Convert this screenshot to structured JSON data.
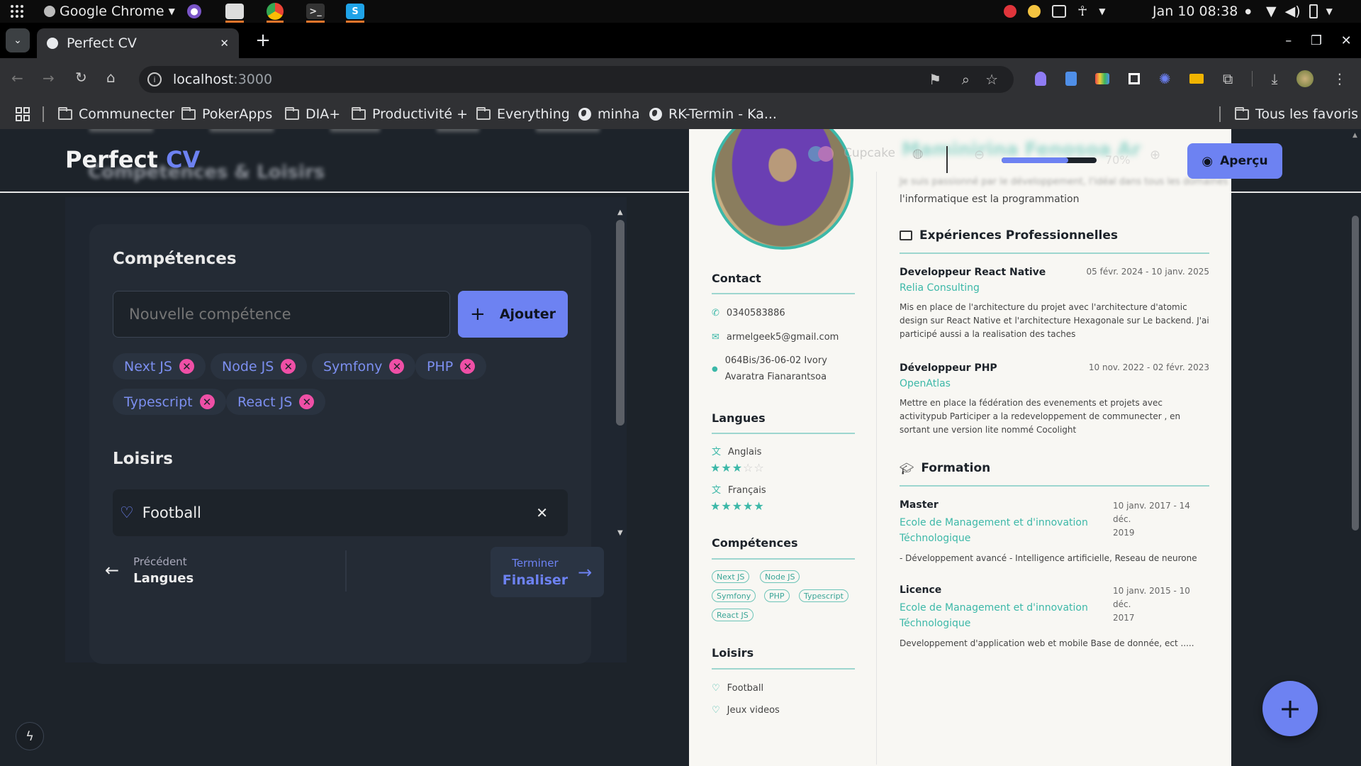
{
  "system_bar": {
    "app_menu": "Google Chrome",
    "clock": "Jan 10  08:38"
  },
  "browser": {
    "tab_title": "Perfect CV",
    "url_host": "localhost",
    "url_port": ":3000",
    "bookmarks": [
      "Communecter",
      "PokerApps",
      "DIA+",
      "Productivité +",
      "Everything",
      "minha",
      "RK-Termin - Ka...",
      "Tous les favoris"
    ]
  },
  "app": {
    "logo_main": "Perfect",
    "logo_accent": "CV",
    "theme_name": "Cupcake",
    "zoom": "70%",
    "zoom_fraction": 0.7,
    "preview_label": "Aperçu",
    "blur_title": "Compétences & Loisirs"
  },
  "editor": {
    "skills_heading": "Compétences",
    "skill_placeholder": "Nouvelle compétence",
    "add_label": "Ajouter",
    "skills": [
      "Next JS",
      "Node JS",
      "Symfony",
      "PHP",
      "Typescript",
      "React JS"
    ],
    "hobbies_heading": "Loisirs",
    "hobby": "Football",
    "prev_caption": "Précédent",
    "prev_label": "Langues",
    "next_caption": "Terminer",
    "next_label": "Finaliser"
  },
  "cv": {
    "blur_name": "Maminirina Fenosoa Ar",
    "summary_line1": "Je suis passionné par le développement, l'idéal dans tous les domaines",
    "summary_line2": "l'informatique est la programmation",
    "contact_heading": "Contact",
    "phone": "0340583886",
    "email": "armelgeek5@gmail.com",
    "address_line1": "064Bis/36-06-02 Ivory",
    "address_line2": "Avaratra Fianarantsoa",
    "languages_heading": "Langues",
    "languages": [
      {
        "name": "Anglais",
        "rating": 3,
        "max": 5
      },
      {
        "name": "Français",
        "rating": 5,
        "max": 5
      }
    ],
    "skills_heading": "Compétences",
    "skills": [
      "Next JS",
      "Node JS",
      "Symfony",
      "PHP",
      "Typescript",
      "React JS"
    ],
    "hobbies_heading": "Loisirs",
    "hobbies": [
      "Football",
      "Jeux videos"
    ],
    "experience_heading": "Expériences Professionnelles",
    "experiences": [
      {
        "title": "Developpeur React Native",
        "dates": "05 févr. 2024 - 10 janv. 2025",
        "company": "Relia Consulting",
        "desc": "Mis en place de l'architecture du projet avec l'architecture d'atomic design sur React Native et l'architecture Hexagonale sur Le backend. J'ai participé aussi a la realisation des taches"
      },
      {
        "title": "Développeur PHP",
        "dates": "10 nov. 2022 - 02 févr. 2023",
        "company": "OpenAtlas",
        "desc": "Mettre en place la fédération des evenements et projets avec activitypub Participer a la redeveloppement de communecter , en sortant une version lite nommé Cocolight"
      }
    ],
    "education_heading": "Formation",
    "education": [
      {
        "degree": "Master",
        "dates_line1": "10 janv. 2017 - 14 déc.",
        "dates_line2": "2019",
        "school_line1": "Ecole de Management et d'innovation",
        "school_line2": "Téchnologique",
        "desc": "- Développement avancé - Intelligence artificielle, Reseau de neurone"
      },
      {
        "degree": "Licence",
        "dates_line1": "10 janv. 2015 - 10 déc.",
        "dates_line2": "2017",
        "school_line1": "Ecole de Management et d'innovation",
        "school_line2": "Téchnologique",
        "desc": "Developpement d'application web et mobile Base de donnée, ect ....."
      }
    ]
  },
  "colors": {
    "primary": "#6d82f2",
    "accent_pink": "#ef4fa6",
    "teal": "#3cb8a8",
    "page_bg": "#1d232a"
  }
}
